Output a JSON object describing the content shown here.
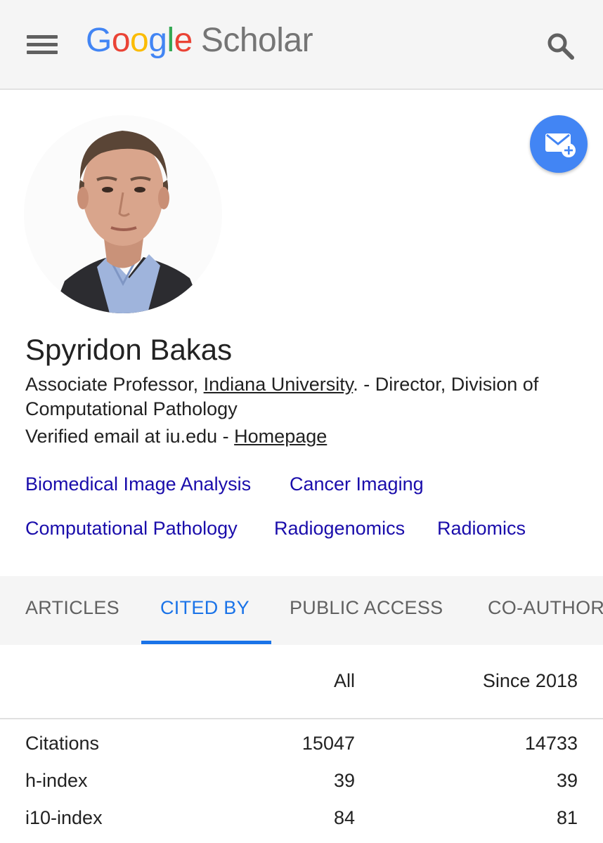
{
  "header": {
    "logo_google": [
      "G",
      "o",
      "o",
      "g",
      "l",
      "e"
    ],
    "logo_google_colors": [
      "#4285f4",
      "#ea4335",
      "#fbbc05",
      "#4285f4",
      "#34a853",
      "#ea4335"
    ],
    "logo_scholar": "Scholar",
    "menu_icon": "hamburger-menu-icon",
    "search_icon": "search-icon"
  },
  "profile": {
    "name": "Spyridon Bakas",
    "affiliation_prefix": "Associate Professor, ",
    "affiliation_link": "Indiana University",
    "affiliation_suffix": ". - Director, Division of Computational Pathology",
    "email_text": "Verified email at iu.edu - ",
    "homepage_link": "Homepage",
    "follow_icon": "email-follow-icon",
    "follow_color": "#4285f4"
  },
  "interests": [
    "Biomedical Image Analysis",
    "Cancer Imaging",
    "Computational Pathology",
    "Radiogenomics",
    "Radiomics"
  ],
  "tabs": [
    "ARTICLES",
    "CITED BY",
    "PUBLIC ACCESS",
    "CO-AUTHORS"
  ],
  "active_tab": "CITED BY",
  "citations_table": {
    "columns": [
      "All",
      "Since 2018"
    ],
    "rows": [
      {
        "label": "Citations",
        "all": "15047",
        "since": "14733"
      },
      {
        "label": "h-index",
        "all": "39",
        "since": "39"
      },
      {
        "label": "i10-index",
        "all": "84",
        "since": "81"
      }
    ]
  },
  "colors": {
    "link_blue": "#1a0dab",
    "accent_blue": "#1a73e8",
    "topbar_bg": "#f5f5f5"
  }
}
